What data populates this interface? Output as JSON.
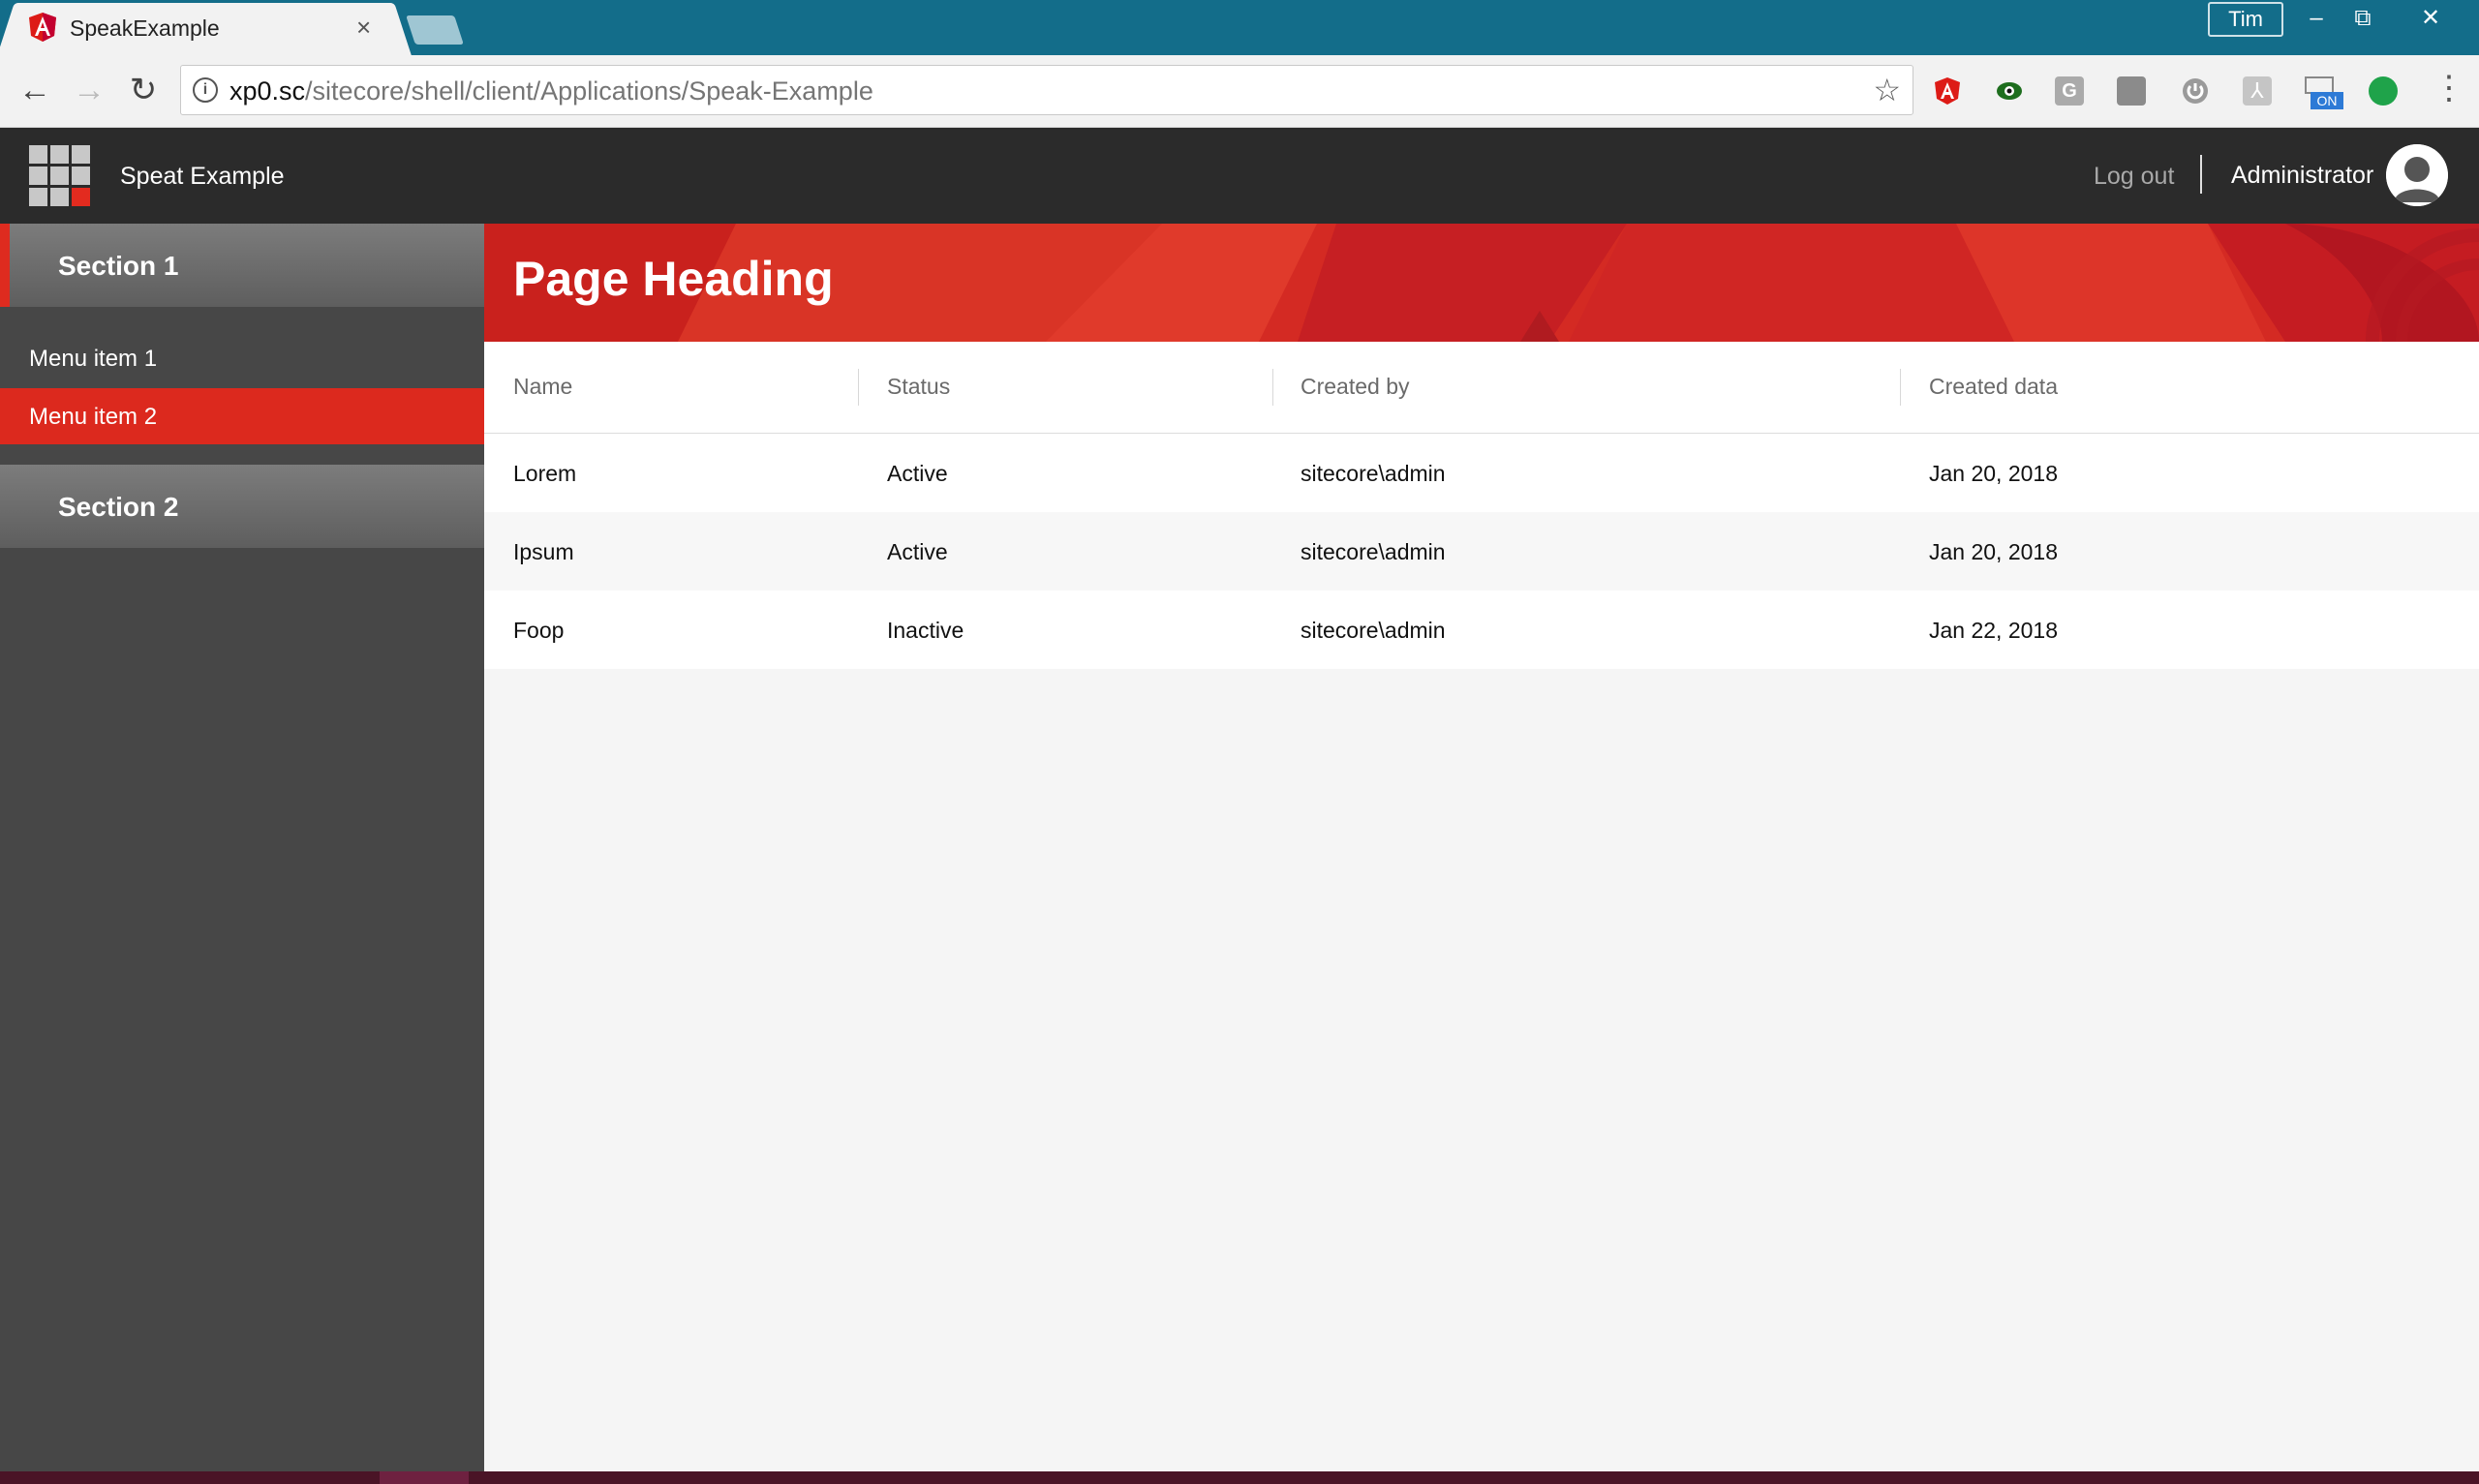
{
  "browser": {
    "tab_title": "SpeakExample",
    "tab_close": "×",
    "profile_name": "Tim",
    "url_host": "xp0.sc",
    "url_path": "/sitecore/shell/client/Applications/Speak-Example",
    "window_controls": {
      "minimize": "–",
      "restore": "⧉",
      "close": "✕"
    },
    "extensions": [
      "angular-icon",
      "eye-extension-icon",
      "g-extension-icon",
      "shield-extension-icon",
      "power-extension-icon",
      "pdf-extension-icon",
      "on-extension-icon",
      "green-dot-extension-icon"
    ],
    "extension_badge": "ON"
  },
  "app": {
    "title": "Speat Example",
    "logout_label": "Log out",
    "user_name": "Administrator"
  },
  "sidebar": {
    "sections": [
      {
        "label": "Section 1",
        "items": [
          {
            "label": "Menu item 1"
          },
          {
            "label": "Menu item 2"
          }
        ]
      },
      {
        "label": "Section 2",
        "items": []
      }
    ]
  },
  "main": {
    "heading": "Page Heading",
    "table": {
      "columns": [
        "Name",
        "Status",
        "Created by",
        "Created data"
      ],
      "rows": [
        [
          "Lorem",
          "Active",
          "sitecore\\admin",
          "Jan 20, 2018"
        ],
        [
          "Ipsum",
          "Active",
          "sitecore\\admin",
          "Jan 20, 2018"
        ],
        [
          "Foop",
          "Inactive",
          "sitecore\\admin",
          "Jan 22, 2018"
        ]
      ]
    }
  },
  "colors": {
    "accent_red": "#dc291e",
    "header_dark": "#2b2b2b",
    "sidebar_bg": "#474747",
    "titlebar_blue": "#136d8a"
  }
}
